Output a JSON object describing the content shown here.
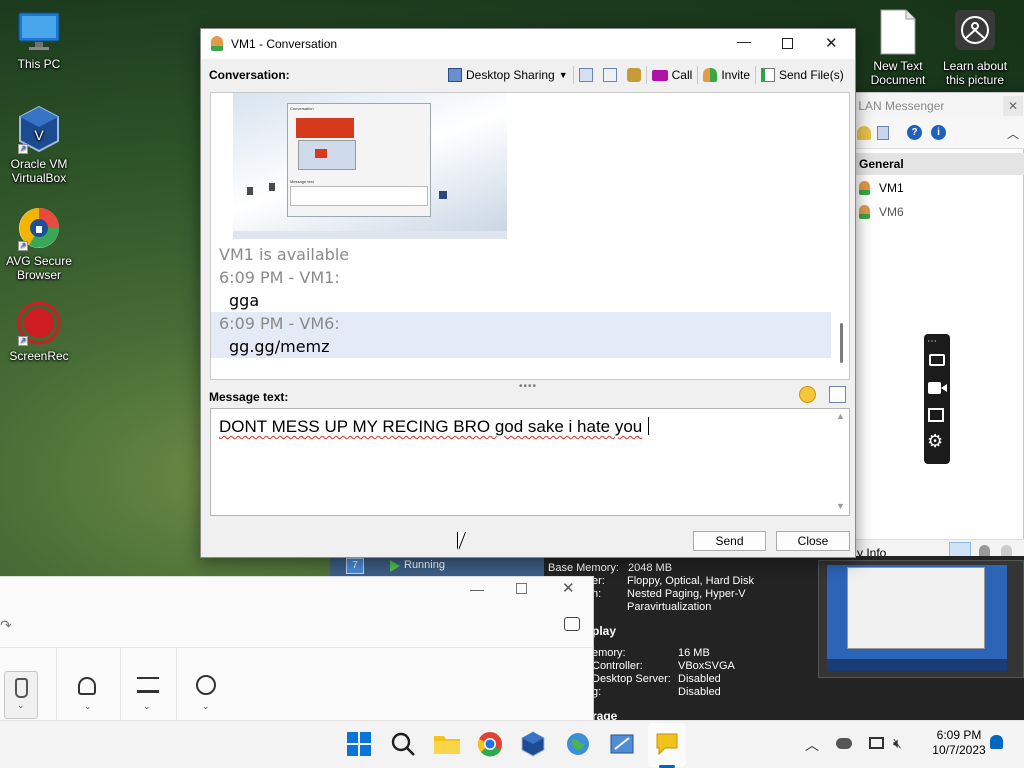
{
  "desktop": {
    "icons": [
      {
        "label": "This PC"
      },
      {
        "label": "Oracle VM VirtualBox"
      },
      {
        "label": "AVG Secure Browser"
      },
      {
        "label": "ScreenRec"
      },
      {
        "label": "New Text Document"
      },
      {
        "label": "Learn about this picture"
      }
    ]
  },
  "conv": {
    "title": "VM1 - Conversation",
    "header_label": "Conversation:",
    "toolbar": {
      "desktop_sharing": "Desktop Sharing",
      "call": "Call",
      "invite": "Invite",
      "send_files": "Send File(s)"
    },
    "messages": [
      {
        "text": "VM1 is available",
        "kind": "status"
      },
      {
        "text": "6:09 PM - VM1:",
        "kind": "header"
      },
      {
        "text": "gga",
        "kind": "body"
      },
      {
        "text": "6:09 PM - VM6:",
        "kind": "header",
        "highlight": true
      },
      {
        "text": "gg.gg/memz",
        "kind": "body",
        "highlight": true
      }
    ],
    "message_label": "Message text:",
    "input_value": "DONT MESS UP MY RECING BRO god sake i hate you",
    "send": "Send",
    "close": "Close",
    "thumb": {
      "conversation": "Conversation",
      "message": "Message text"
    }
  },
  "lan": {
    "title_partial": "s LAN Messenger",
    "group": "General",
    "users": [
      "VM1",
      "VM6"
    ],
    "status_partial": "y Info"
  },
  "vbox": {
    "running": "Running",
    "general": [
      [
        "Base Memory:",
        "2048 MB"
      ],
      [
        "er:",
        "Floppy, Optical, Hard Disk"
      ],
      [
        "n:",
        "Nested Paging, Hyper-V"
      ],
      [
        "",
        "Paravirtualization"
      ]
    ],
    "display_header": "play",
    "display": [
      [
        "emory:",
        "16 MB"
      ],
      [
        "Controller:",
        "VBoxSVGA"
      ],
      [
        "Desktop Server:",
        "Disabled"
      ],
      [
        "g:",
        "Disabled"
      ]
    ],
    "storage_partial": "rage"
  },
  "taskbar": {
    "time": "6:09 PM",
    "date": "10/7/2023"
  },
  "colors": {
    "accent": "#0067c0",
    "highlight": "#e5ebf6",
    "spell": "#d9342b",
    "taskbar": "#f3f3f3"
  }
}
